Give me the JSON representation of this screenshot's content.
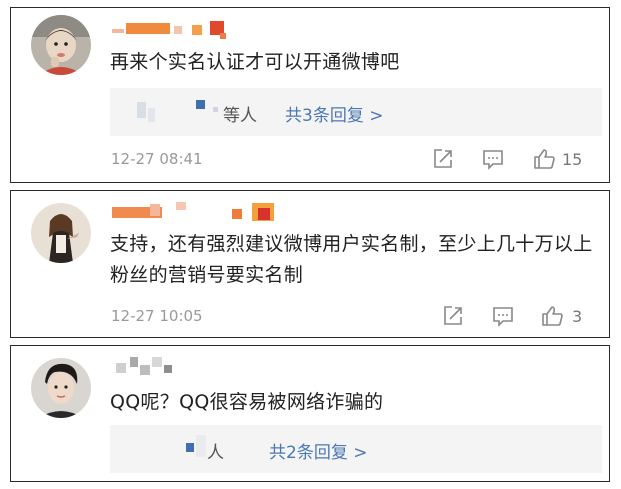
{
  "comments": [
    {
      "text": "再来个实名认证才可以开通微博吧",
      "replies": {
        "suffix": "等人",
        "more": "共3条回复 >"
      },
      "time": "12-27 08:41",
      "likes": "15"
    },
    {
      "text": "支持，还有强烈建议微博用户实名制，至少上几十万以上粉丝的营销号要实名制",
      "time": "12-27 10:05",
      "likes": "3"
    },
    {
      "text": "QQ呢？QQ很容易被网络诈骗的",
      "replies": {
        "suffix": "人",
        "more": "共2条回复 >"
      }
    }
  ],
  "icons": {
    "share": "share-icon",
    "comment": "comment-icon",
    "like": "like-icon"
  },
  "colors": {
    "link": "#4b77b3",
    "meta": "#999999",
    "border": "#2b2b2b",
    "reply_bg": "#f4f4f4"
  }
}
